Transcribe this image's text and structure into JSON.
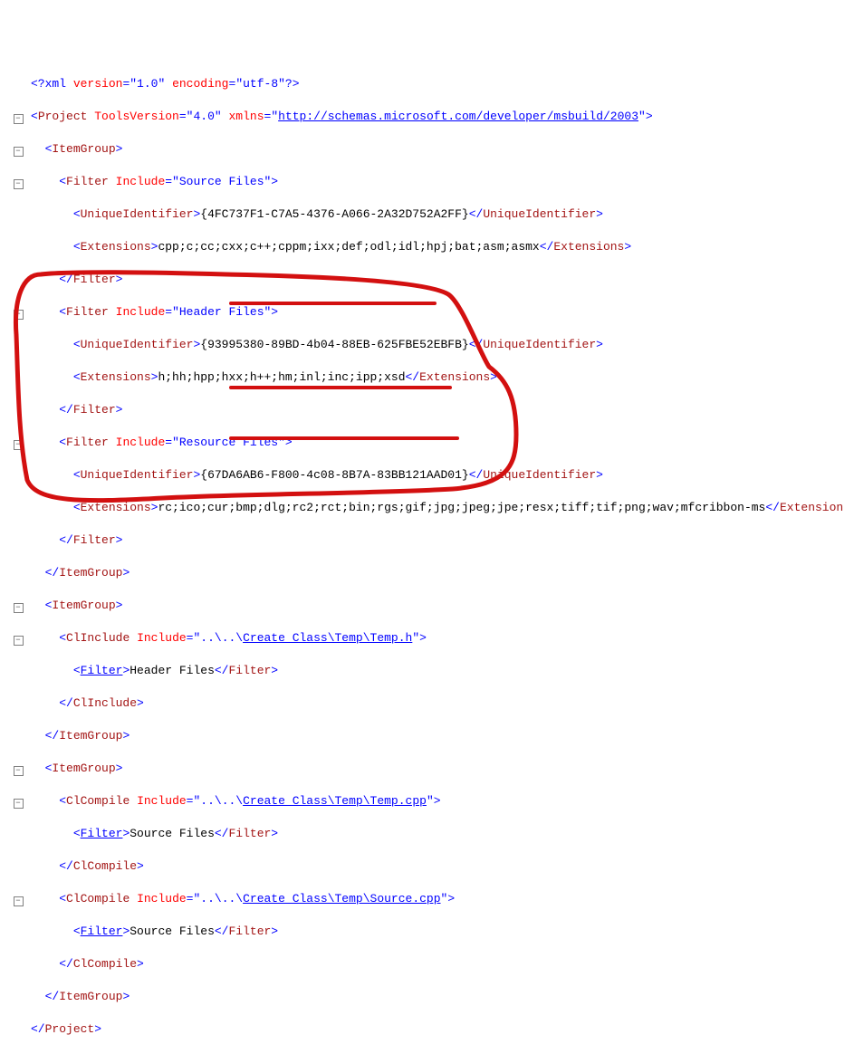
{
  "xml": {
    "declaration_pi_open": "<?",
    "declaration_name": "xml",
    "version_attr": "version",
    "version_val": "\"1.0\"",
    "encoding_attr": "encoding",
    "encoding_val": "\"utf-8\"",
    "declaration_pi_close": "?>"
  },
  "project": {
    "open_tag": "Project",
    "tools_attr": "ToolsVersion",
    "tools_val": "\"4.0\"",
    "xmlns_attr": "xmlns",
    "xmlns_val": "http://schemas.microsoft.com/developer/msbuild/2003",
    "close_tag": "Project"
  },
  "itemgroup": "ItemGroup",
  "filter_tag": "Filter",
  "include_attr": "Include",
  "source_files": "\"Source Files\"",
  "header_files": "\"Header Files\"",
  "resource_files": "\"Resource Files\"",
  "uid_tag": "UniqueIdentifier",
  "ext_tag": "Extensions",
  "filter1_uid": "{4FC737F1-C7A5-4376-A066-2A32D752A2FF}",
  "filter1_ext": "cpp;c;cc;cxx;c++;cppm;ixx;def;odl;idl;hpj;bat;asm;asmx",
  "filter2_uid": "{93995380-89BD-4b04-88EB-625FBE52EBFB}",
  "filter2_ext": "h;hh;hpp;hxx;h++;hm;inl;inc;ipp;xsd",
  "filter3_uid": "{67DA6AB6-F800-4c08-8B7A-83BB121AAD01}",
  "filter3_ext": "rc;ico;cur;bmp;dlg;rc2;rct;bin;rgs;gif;jpg;jpeg;jpe;resx;tiff;tif;png;wav;mfcribbon-ms",
  "clinclude_tag": "ClInclude",
  "clcompile_tag": "ClCompile",
  "path_prefix": "\"..\\..\\",
  "path_temp_h": "Create_Class\\Temp\\Temp.h",
  "path_temp_cpp": "Create_Class\\Temp\\Temp.cpp",
  "path_source_cpp": "Create_Class\\Temp\\Source.cpp",
  "filter_header_text": "Header Files",
  "filter_source_text": "Source Files",
  "extension_truncated": "Extension"
}
